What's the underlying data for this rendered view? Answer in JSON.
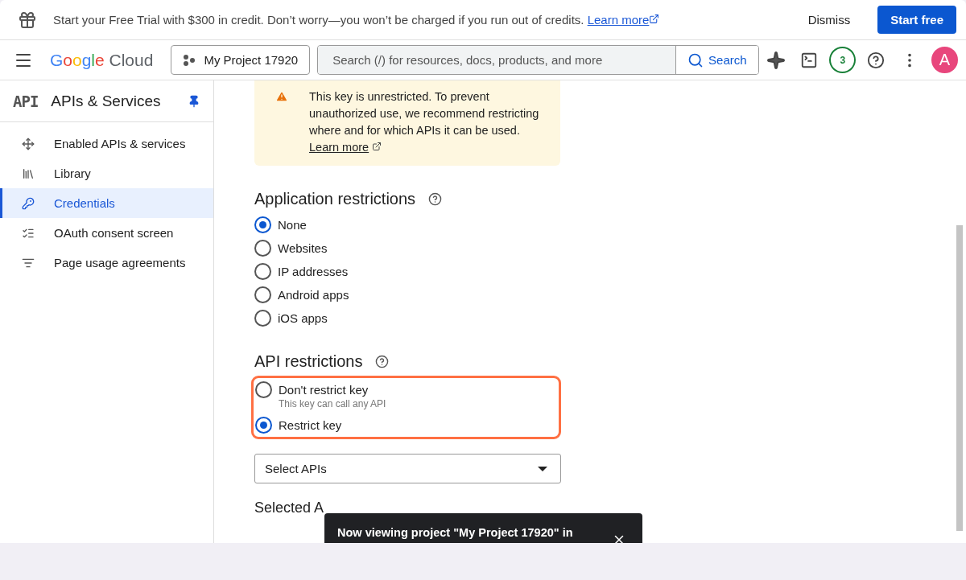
{
  "banner": {
    "message": "Start your Free Trial with $300 in credit. Don’t worry—you won’t be charged if you run out of credits.",
    "link": "Learn more",
    "dismiss": "Dismiss",
    "start": "Start free"
  },
  "header": {
    "brand": "Google",
    "product": "Cloud",
    "project": "My Project 17920",
    "search_placeholder": "Search (/) for resources, docs, products, and more",
    "search_button": "Search",
    "notifications": "3",
    "avatar": "A"
  },
  "sidebar": {
    "badge": "API",
    "title": "APIs & Services",
    "items": [
      {
        "label": "Enabled APIs & services",
        "kind": "move",
        "selected": false
      },
      {
        "label": "Library",
        "kind": "library",
        "selected": false
      },
      {
        "label": "Credentials",
        "kind": "key",
        "selected": true
      },
      {
        "label": "OAuth consent screen",
        "kind": "consent",
        "selected": false
      },
      {
        "label": "Page usage agreements",
        "kind": "agreements",
        "selected": false
      }
    ]
  },
  "notice": {
    "text": "This key is unrestricted. To prevent unauthorized use, we recommend restricting where and for which APIs it can be used.",
    "link": "Learn more"
  },
  "application_restrictions": {
    "title": "Application restrictions",
    "options": [
      {
        "label": "None",
        "selected": true
      },
      {
        "label": "Websites",
        "selected": false
      },
      {
        "label": "IP addresses",
        "selected": false
      },
      {
        "label": "Android apps",
        "selected": false
      },
      {
        "label": "iOS apps",
        "selected": false
      }
    ]
  },
  "api_restrictions": {
    "title": "API restrictions",
    "highlighted": true,
    "options": [
      {
        "label": "Don't restrict key",
        "hint": "This key can call any API",
        "selected": false
      },
      {
        "label": "Restrict key",
        "selected": true
      }
    ]
  },
  "select": {
    "value": "Select APIs"
  },
  "selected_heading": "Selected A",
  "toast": {
    "text": "Now viewing project \"My Project 17920\" in"
  }
}
